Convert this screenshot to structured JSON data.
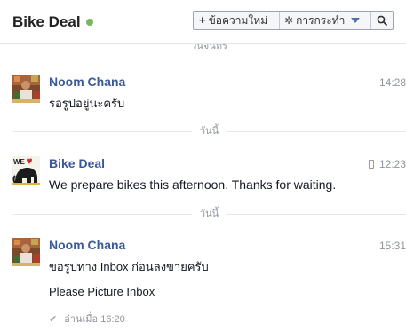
{
  "header": {
    "title": "Bike Deal",
    "new_message_label": "ข้อความใหม่",
    "actions_label": "การกระทำ"
  },
  "dividers": {
    "top_partial": "วันจันทร์",
    "today_1": "วันนี้",
    "today_2": "วันนี้"
  },
  "messages": [
    {
      "sender": "Noom Chana",
      "time": "14:28",
      "lines": [
        "รอรูปอยู่นะครับ"
      ]
    },
    {
      "sender": "Bike Deal",
      "time": "12:23",
      "lines": [
        "We prepare bikes this afternoon. Thanks for waiting."
      ],
      "via_mobile": true,
      "avatar_text": "WE"
    },
    {
      "sender": "Noom Chana",
      "time": "15:31",
      "lines": [
        "ขอรูปทาง Inbox ก่อนลงขายครับ",
        "Please Picture Inbox"
      ]
    }
  ],
  "seen_status": "อ่านเมื่อ 16:20",
  "colors": {
    "sender_blue": "#3b5998",
    "online_green": "#79b75d"
  }
}
